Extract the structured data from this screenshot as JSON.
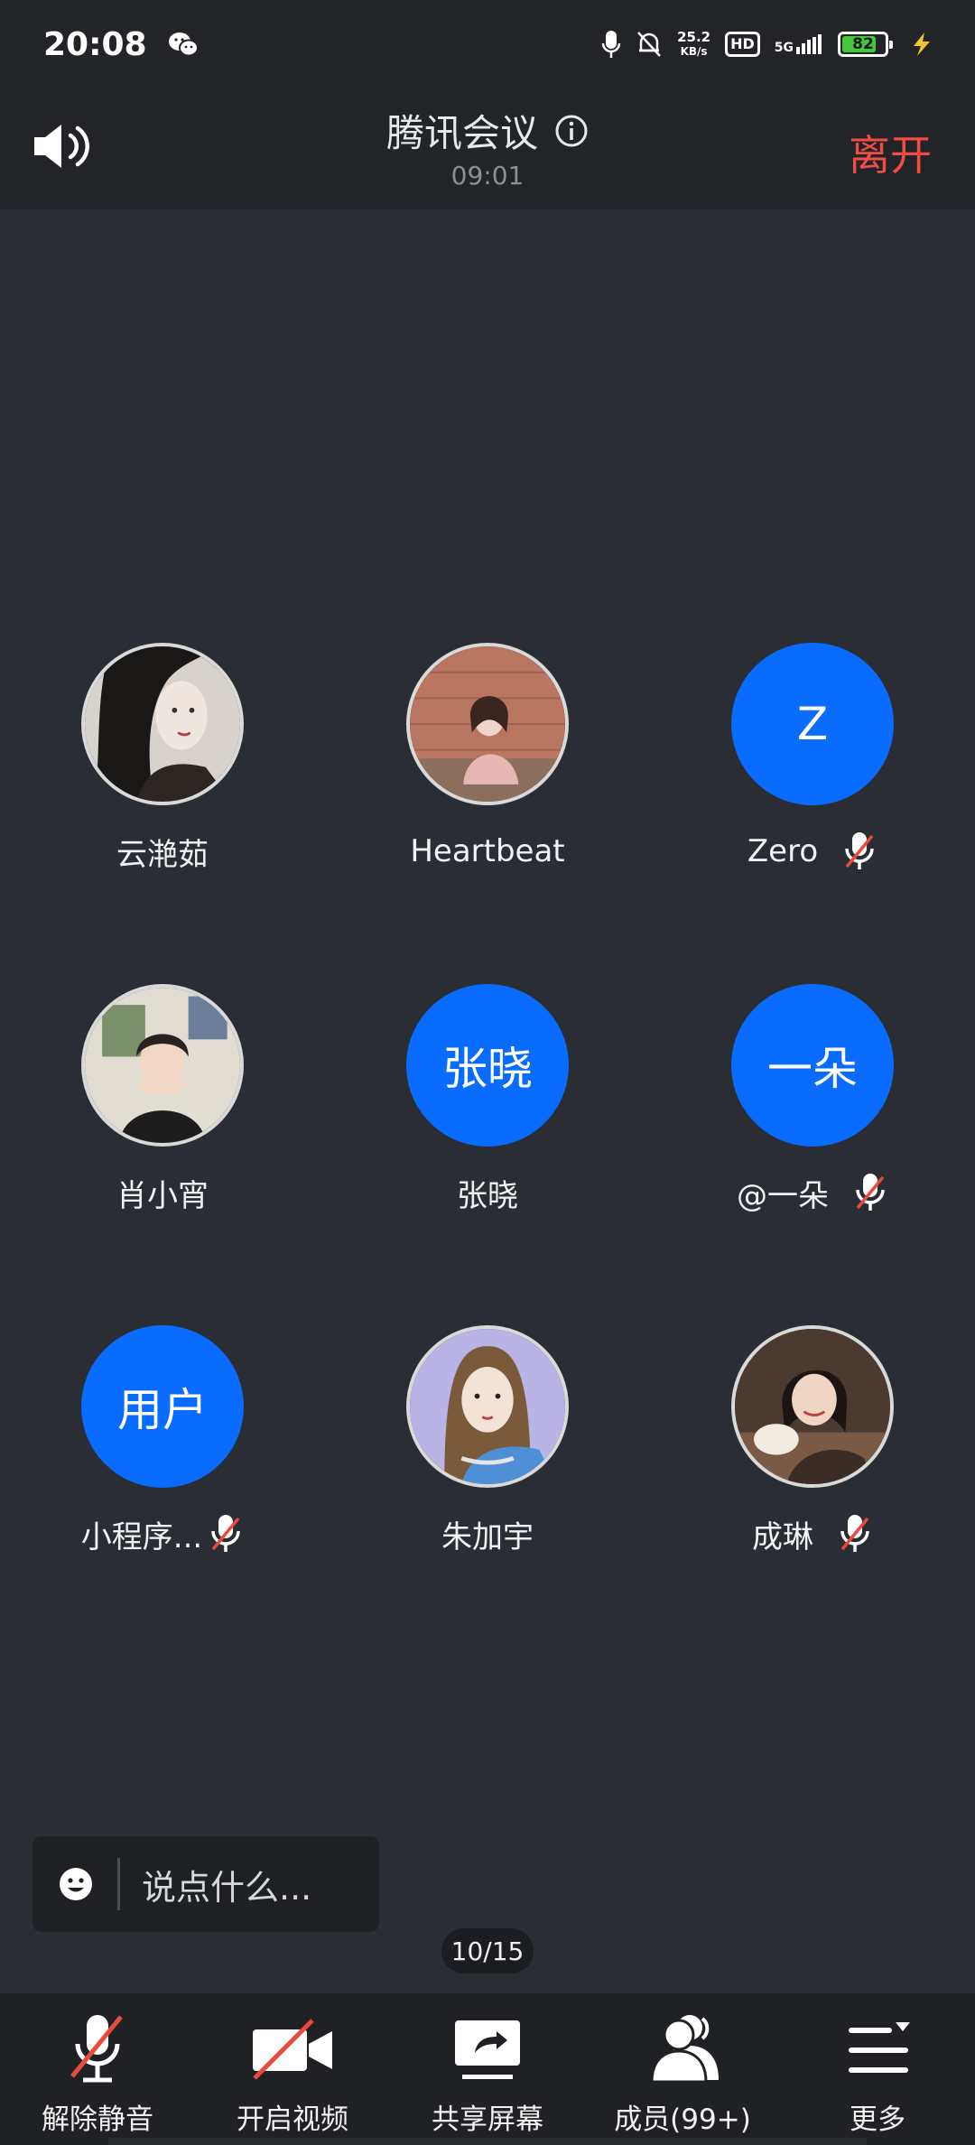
{
  "status_bar": {
    "time": "20:08",
    "net_speed_value": "25.2",
    "net_speed_unit": "KB/s",
    "hd_label": "HD",
    "signal_label": "5G",
    "battery_level": "82",
    "battery_fraction": 0.82,
    "battery_color": "#45c83b"
  },
  "header": {
    "title": "腾讯会议",
    "timer": "09:01",
    "leave_label": "离开",
    "leave_color": "#f14c45"
  },
  "participants": [
    {
      "name": "云滟茹",
      "avatar_type": "photo",
      "muted": false
    },
    {
      "name": "Heartbeat",
      "avatar_type": "photo",
      "muted": false
    },
    {
      "name": "Zero",
      "avatar_type": "text",
      "avatar_text": "Z",
      "muted": true
    },
    {
      "name": "肖小宵",
      "avatar_type": "photo",
      "muted": false
    },
    {
      "name": "张晓",
      "avatar_type": "text",
      "avatar_text": "张晓",
      "muted": false
    },
    {
      "name": "@一朵",
      "avatar_type": "text",
      "avatar_text": "一朵",
      "muted": true
    },
    {
      "name": "小程序...",
      "avatar_type": "text",
      "avatar_text": "用户",
      "muted": true
    },
    {
      "name": "朱加宇",
      "avatar_type": "photo",
      "muted": false
    },
    {
      "name": "成琳",
      "avatar_type": "photo",
      "muted": true
    }
  ],
  "avatar_color": "#0a6cff",
  "chat": {
    "placeholder": "说点什么..."
  },
  "page_indicator": "10/15",
  "toolbar": {
    "unmute": "解除静音",
    "start_video": "开启视频",
    "share_screen": "共享屏幕",
    "members": "成员(99+)",
    "more": "更多"
  }
}
